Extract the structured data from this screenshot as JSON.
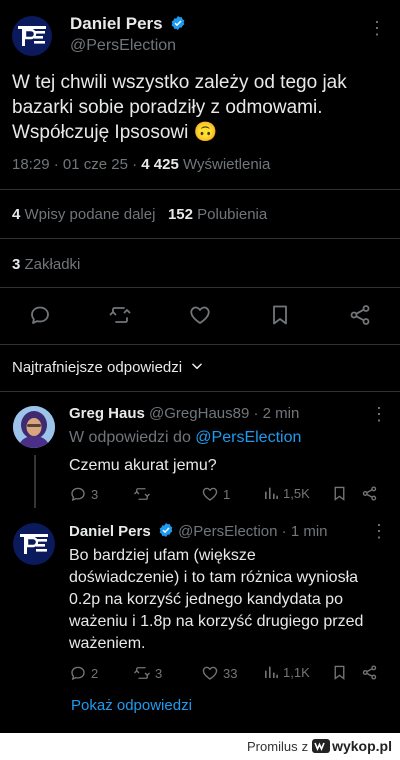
{
  "main_tweet": {
    "author_name": "Daniel Pers",
    "author_handle": "@PersElection",
    "text_line1": "W tej chwili wszystko zależy od tego jak",
    "text_line2": "bazarki sobie poradziły z odmowami.",
    "text_line3": "Współczuję Ipsosowi",
    "emoji": "🙃",
    "time": "18:29 · 01 cze 25 · ",
    "views_count": "4 425",
    "views_label": "Wyświetlenia",
    "retweets_count": "4",
    "retweets_label": "Wpisy podane dalej",
    "likes_count": "152",
    "likes_label": "Polubienia",
    "bookmarks_count": "3",
    "bookmarks_label": "Zakładki"
  },
  "replies_filter": {
    "label": "Najtrafniejsze odpowiedzi",
    "icon": "chevron-down-icon"
  },
  "replies": [
    {
      "author_name": "Greg Haus",
      "author_handle": "@GregHaus89",
      "time": "· 2 min",
      "replying_prefix": "W odpowiedzi do ",
      "replying_handle": "@PersElection",
      "text": "Czemu akurat jemu?",
      "reply_count": "3",
      "retweet_count": "",
      "like_count": "1",
      "view_count": "1,5K"
    },
    {
      "author_name": "Daniel Pers",
      "author_handle": "@PersElection",
      "time": "· 1 min",
      "text_lines": [
        "Bo bardziej ufam (większe",
        "doświadczenie) i to tam różnica wyniosła",
        "0.2p na korzyść jednego kandydata po",
        "ważeniu i 1.8p na korzyść drugiego przed",
        "ważeniem."
      ],
      "reply_count": "2",
      "retweet_count": "3",
      "like_count": "33",
      "view_count": "1,1K"
    }
  ],
  "show_replies": "Pokaż odpowiedzi",
  "footer": {
    "user": "Promilus",
    "sep": "z",
    "brand": "wykop.pl"
  },
  "colors": {
    "background": "#000000",
    "text": "#e7e9ea",
    "muted": "#71767b",
    "link": "#1d9bf0",
    "verified": "#1d9bf0"
  }
}
